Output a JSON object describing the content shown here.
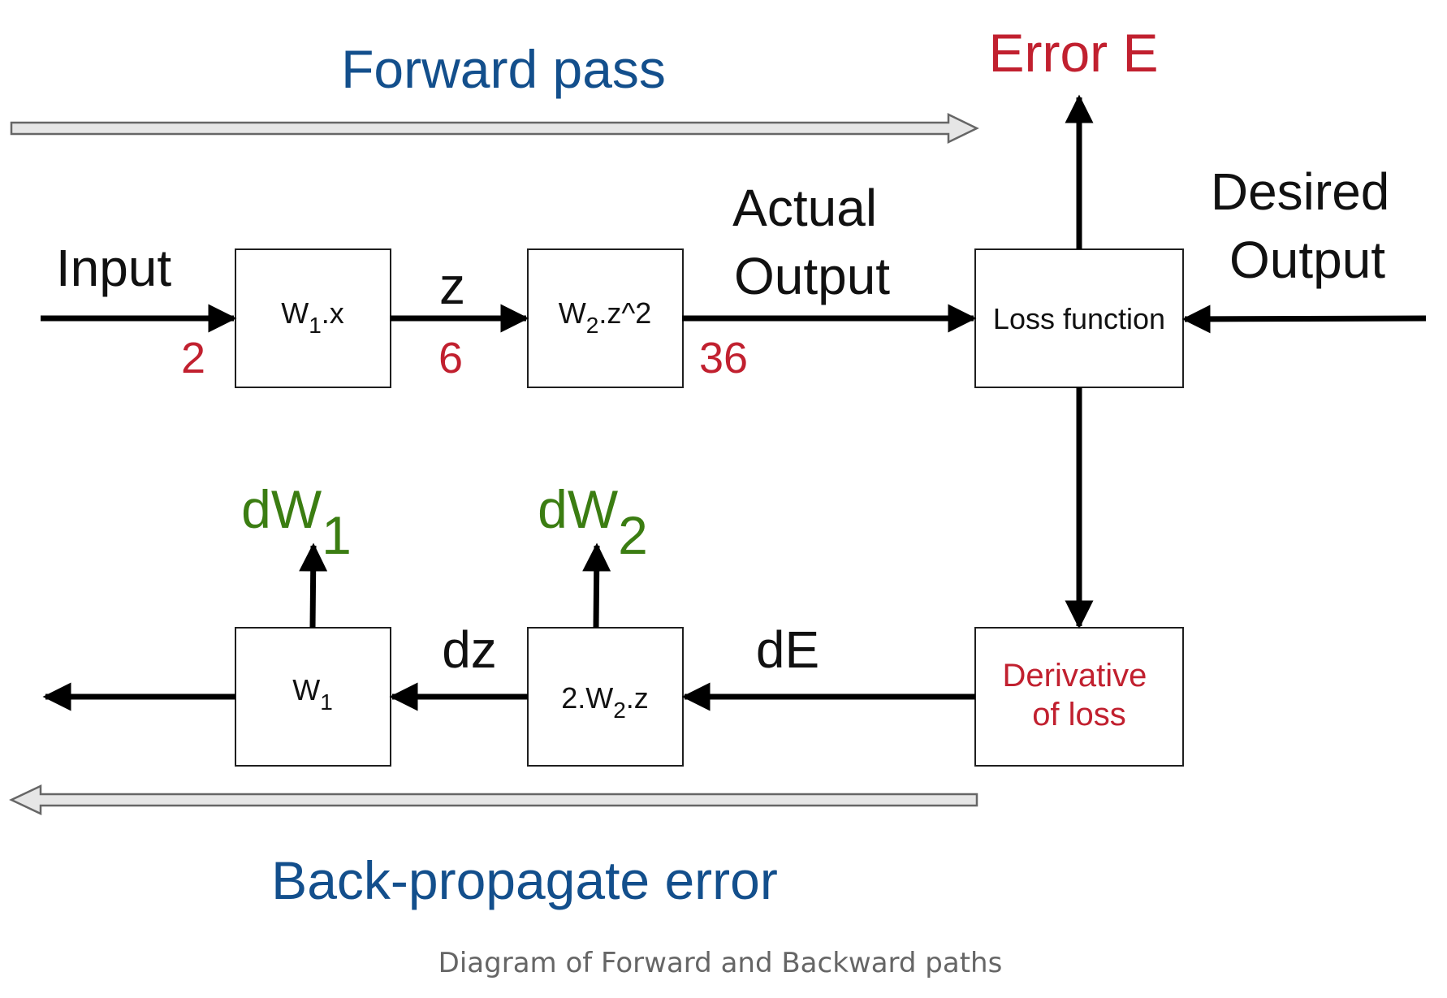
{
  "colors": {
    "blue": "#134f8c",
    "red": "#c1202f",
    "green": "#3b7d12",
    "black": "#111111",
    "caption": "#666666",
    "hollow_arrow_fill": "#e6e6e6"
  },
  "titles": {
    "forward": "Forward pass",
    "backward": "Back-propagate error",
    "error": "Error E"
  },
  "labels": {
    "input": "Input",
    "z": "z",
    "actual_output": [
      "Actual",
      "Output"
    ],
    "desired_output": [
      "Desired",
      "Output"
    ],
    "dz": "dz",
    "dE": "dE"
  },
  "values": {
    "input": "2",
    "z": "6",
    "output": "36"
  },
  "boxes": {
    "w1x": {
      "main": "W",
      "sub": "1",
      "tail": ".x"
    },
    "w2z2": {
      "main": "W",
      "sub": "2",
      "tail": ".z^2"
    },
    "loss": "Loss function",
    "derivative": [
      "Derivative",
      "of loss"
    ],
    "w1": {
      "main": "W",
      "sub": "1"
    },
    "twow2z": {
      "head": "2.W",
      "sub": "2",
      "tail": ".z"
    }
  },
  "gradients": {
    "dw1": {
      "main": "dW",
      "sub": "1"
    },
    "dw2": {
      "main": "dW",
      "sub": "2"
    }
  },
  "caption": "Diagram of Forward and Backward paths"
}
